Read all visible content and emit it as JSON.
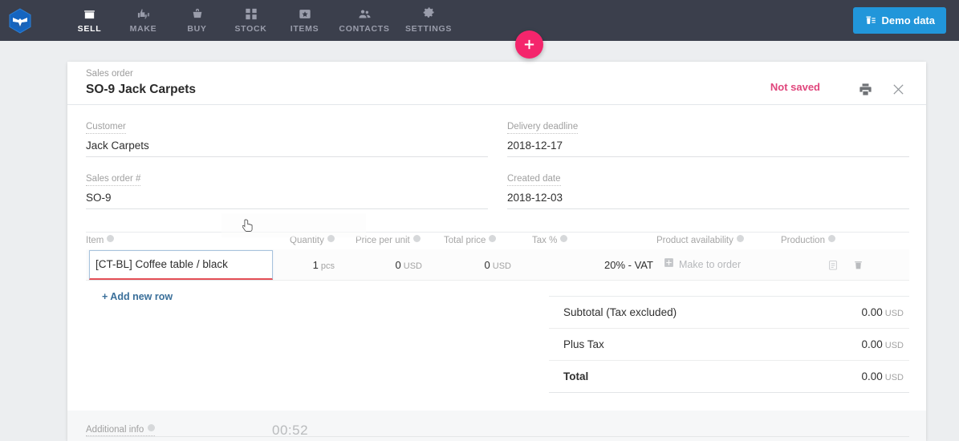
{
  "topnav": {
    "logo_icon": "mrpeasy-hexagon-logo",
    "items": [
      {
        "label": "SELL",
        "icon": "storefront-icon",
        "active": true
      },
      {
        "label": "MAKE",
        "icon": "thumbs-icon",
        "active": false
      },
      {
        "label": "BUY",
        "icon": "shopping-basket-icon",
        "active": false
      },
      {
        "label": "STOCK",
        "icon": "boxes-grid-icon",
        "active": false
      },
      {
        "label": "ITEMS",
        "icon": "star-tag-icon",
        "active": false
      },
      {
        "label": "CONTACTS",
        "icon": "people-icon",
        "active": false
      },
      {
        "label": "SETTINGS",
        "icon": "gear-icon",
        "active": false
      }
    ],
    "demo_button": {
      "label": "Demo data",
      "icon": "trash-list-icon",
      "color": "#2196da"
    },
    "fab": {
      "icon": "plus-icon",
      "color": "#f4256c"
    },
    "bg_color": "#3b3f4c"
  },
  "card": {
    "eyebrow": "Sales order",
    "title": "SO-9 Jack Carpets",
    "status": {
      "text": "Not saved",
      "color": "#e0467c"
    },
    "print_icon": "printer-icon",
    "close_icon": "close-icon"
  },
  "form": {
    "left": [
      {
        "label": "Customer",
        "value": "Jack Carpets"
      },
      {
        "label": "Sales order #",
        "value": "SO-9"
      }
    ],
    "right": [
      {
        "label": "Delivery deadline",
        "value": "2018-12-17"
      },
      {
        "label": "Created date",
        "value": "2018-12-03"
      }
    ]
  },
  "lines": {
    "columns": [
      {
        "label": "Item",
        "info": true
      },
      {
        "label": "Quantity",
        "info": true
      },
      {
        "label": "Price per unit",
        "info": true
      },
      {
        "label": "Total price",
        "info": true
      },
      {
        "label": "Tax %",
        "info": true
      },
      {
        "label": "Product availability",
        "info": true
      },
      {
        "label": "Production",
        "info": true
      }
    ],
    "row": {
      "item_value": "[CT-BL] Coffee table / black",
      "item_placeholder": "",
      "quantity": "1",
      "quantity_unit": "pcs",
      "price_per_unit": "0",
      "price_per_unit_unit": "USD",
      "total_price": "0",
      "total_price_unit": "USD",
      "tax": "20% - VAT",
      "availability_label": "Make to order",
      "availability_icon": "plus-box-icon",
      "notes_icon": "clipboard-icon",
      "delete_icon": "trash-icon"
    },
    "add_row_label": "+ Add new row"
  },
  "totals": [
    {
      "label": "Subtotal (Tax excluded)",
      "value": "0.00",
      "unit": "USD",
      "bold": false
    },
    {
      "label": "Plus Tax",
      "value": "0.00",
      "unit": "USD",
      "bold": false
    },
    {
      "label": "Total",
      "value": "0.00",
      "unit": "USD",
      "bold": true
    }
  ],
  "bottom": {
    "label": "Additional info",
    "info": true,
    "timer": "00:52"
  }
}
